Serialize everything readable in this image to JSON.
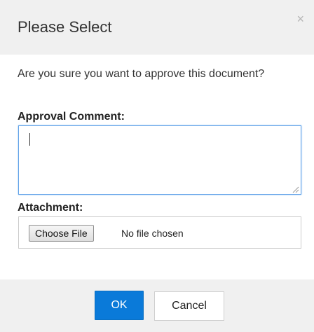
{
  "dialog": {
    "title": "Please Select",
    "close_icon": "close-icon",
    "close_glyph": "×",
    "message": "Are you sure you want to approve this document?"
  },
  "comment": {
    "label": "Approval Comment:",
    "value": ""
  },
  "attachment": {
    "label": "Attachment:",
    "button_label": "Choose File",
    "status": "No file chosen"
  },
  "footer": {
    "ok_label": "OK",
    "cancel_label": "Cancel"
  },
  "colors": {
    "accent": "#0a7ad9",
    "focus_border": "#62a3e8",
    "header_bg": "#f0f0f0"
  }
}
